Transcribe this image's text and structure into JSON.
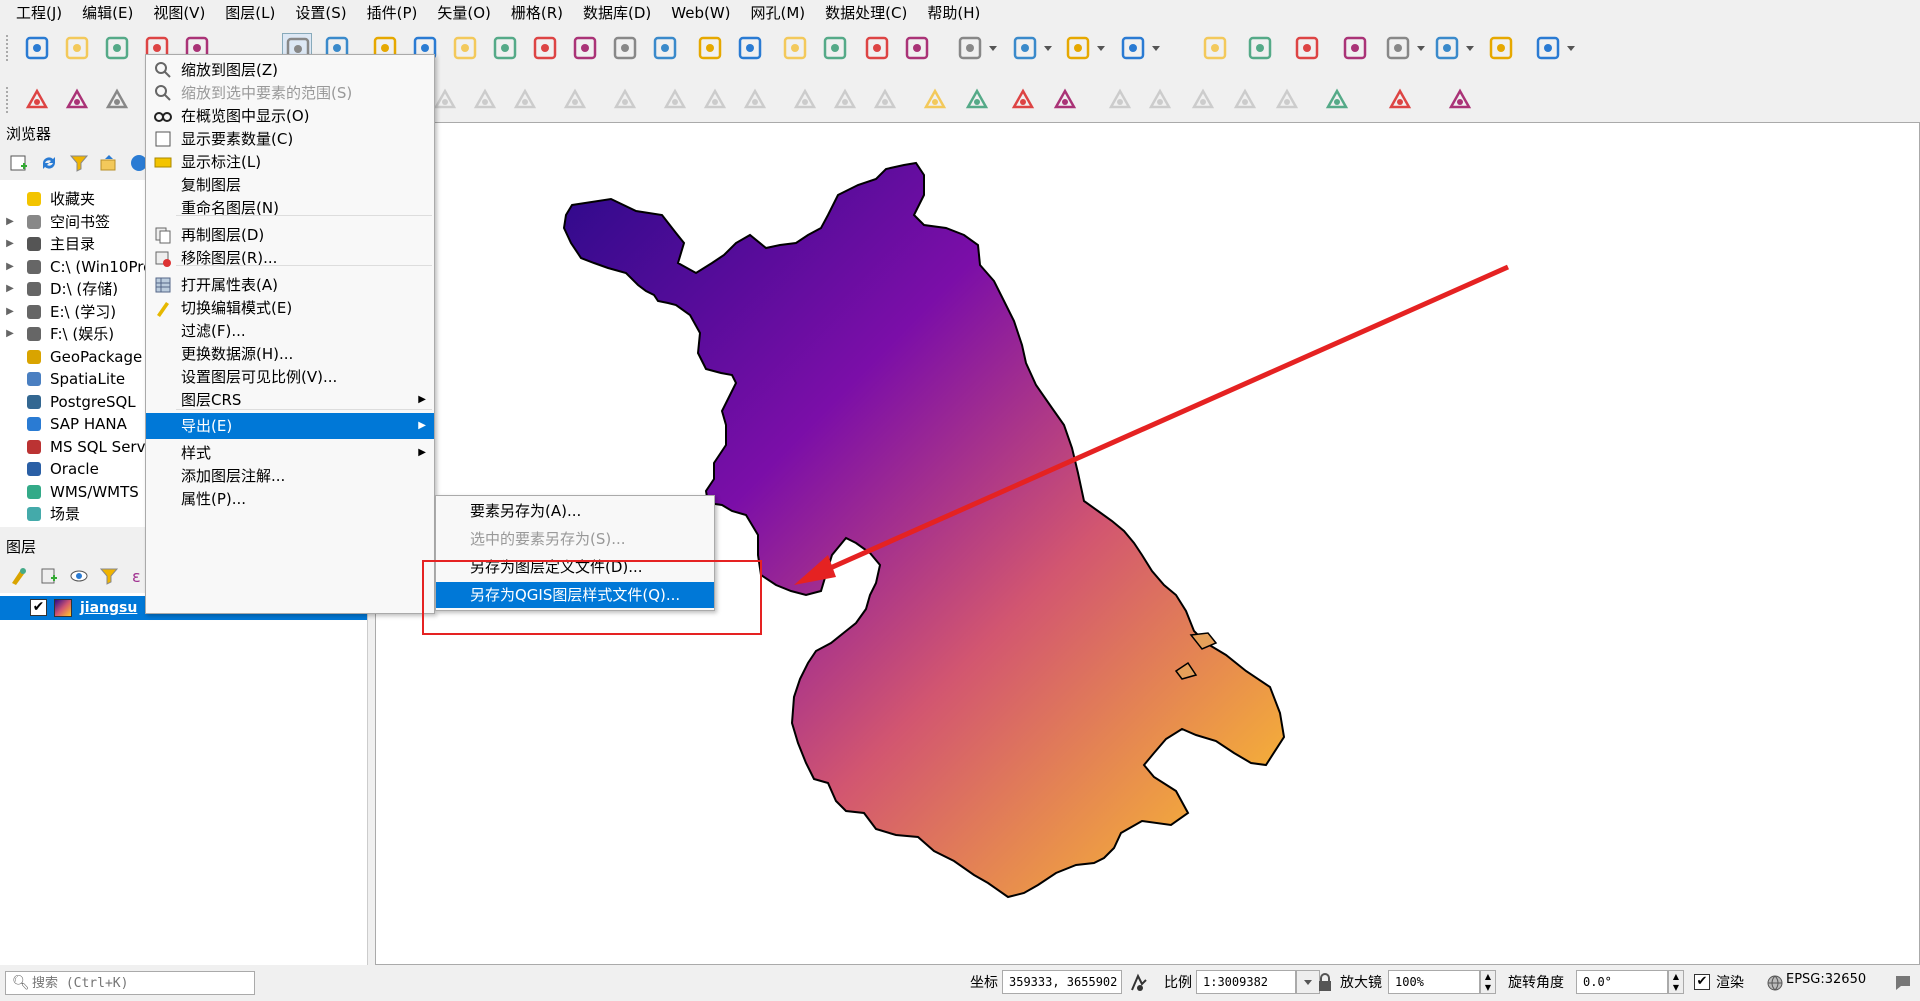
{
  "menubar": [
    "工程(J)",
    "编辑(E)",
    "视图(V)",
    "图层(L)",
    "设置(S)",
    "插件(P)",
    "矢量(O)",
    "栅格(R)",
    "数据库(D)",
    "Web(W)",
    "网孔(M)",
    "数据处理(C)",
    "帮助(H)"
  ],
  "browser": {
    "title": "浏览器",
    "items": [
      {
        "label": "收藏夹",
        "icon": "star-icon",
        "expand": false
      },
      {
        "label": "空间书签",
        "icon": "bookmark-icon",
        "expand": true
      },
      {
        "label": "主目录",
        "icon": "home-icon",
        "expand": true
      },
      {
        "label": "C:\\ (Win10Pro",
        "icon": "drive-icon",
        "expand": true
      },
      {
        "label": "D:\\ (存储)",
        "icon": "drive-icon",
        "expand": true
      },
      {
        "label": "E:\\ (学习)",
        "icon": "drive-icon",
        "expand": true
      },
      {
        "label": "F:\\ (娱乐)",
        "icon": "drive-icon",
        "expand": true
      },
      {
        "label": "GeoPackage",
        "icon": "geopackage-icon",
        "expand": false
      },
      {
        "label": "SpatiaLite",
        "icon": "spatialite-icon",
        "expand": false
      },
      {
        "label": "PostgreSQL",
        "icon": "postgresql-icon",
        "expand": false
      },
      {
        "label": "SAP HANA",
        "icon": "sap-hana-icon",
        "expand": false
      },
      {
        "label": "MS SQL Serv",
        "icon": "mssql-icon",
        "expand": false
      },
      {
        "label": "Oracle",
        "icon": "oracle-icon",
        "expand": false
      },
      {
        "label": "WMS/WMTS",
        "icon": "wms-icon",
        "expand": false
      },
      {
        "label": "场景",
        "icon": "scene-icon",
        "expand": false
      }
    ]
  },
  "layers": {
    "title": "图层",
    "layer_name": "jiangsu",
    "checked": true
  },
  "context_menu": {
    "items": [
      {
        "label": "缩放到图层(Z)",
        "icon": "zoom-layer-icon",
        "disabled": false
      },
      {
        "label": "缩放到选中要素的范围(S)",
        "icon": "zoom-selected-icon",
        "disabled": true
      },
      {
        "label": "在概览图中显示(O)",
        "icon": "overview-icon",
        "disabled": false
      },
      {
        "label": "显示要素数量(C)",
        "icon": "checkbox-icon",
        "disabled": false
      },
      {
        "label": "显示标注(L)",
        "icon": "label-icon",
        "disabled": false
      },
      {
        "label": "复制图层",
        "icon": "",
        "disabled": false
      },
      {
        "label": "重命名图层(N)",
        "icon": "",
        "disabled": false
      },
      {
        "label": "再制图层(D)",
        "icon": "duplicate-icon",
        "disabled": false
      },
      {
        "label": "移除图层(R)...",
        "icon": "remove-icon",
        "disabled": false
      },
      {
        "label": "打开属性表(A)",
        "icon": "table-icon",
        "disabled": false
      },
      {
        "label": "切换编辑模式(E)",
        "icon": "pencil-icon",
        "disabled": false
      },
      {
        "label": "过滤(F)...",
        "icon": "",
        "disabled": false
      },
      {
        "label": "更换数据源(H)...",
        "icon": "",
        "disabled": false
      },
      {
        "label": "设置图层可见比例(V)...",
        "icon": "",
        "disabled": false
      },
      {
        "label": "图层CRS",
        "icon": "",
        "disabled": false,
        "submenu": true
      },
      {
        "label": "导出(E)",
        "icon": "",
        "disabled": false,
        "submenu": true,
        "selected": true
      },
      {
        "label": "样式",
        "icon": "",
        "disabled": false,
        "submenu": true
      },
      {
        "label": "添加图层注解...",
        "icon": "",
        "disabled": false
      },
      {
        "label": "属性(P)...",
        "icon": "",
        "disabled": false
      }
    ]
  },
  "export_submenu": {
    "items": [
      {
        "label": "要素另存为(A)...",
        "disabled": false,
        "selected": false
      },
      {
        "label": "选中的要素另存为(S)...",
        "disabled": true,
        "selected": false
      },
      {
        "label": "另存为图层定义文件(D)...",
        "disabled": false,
        "selected": false
      },
      {
        "label": "另存为QGIS图层样式文件(Q)...",
        "disabled": false,
        "selected": true
      }
    ]
  },
  "status": {
    "search_placeholder": "搜索 (Ctrl+K)",
    "coord_label": "坐标",
    "coord_value": "359333, 3655902",
    "scale_label": "比例",
    "scale_value": "1:3009382",
    "magnifier_label": "放大镜",
    "magnifier_value": "100%",
    "rotation_label": "旋转角度",
    "rotation_value": "0.0°",
    "render_label": "渲染",
    "crs": "EPSG:32650"
  },
  "colors": {
    "selection": "#0078d7",
    "annotation_red": "#e52222",
    "gradient_start": "#2c0a8a",
    "gradient_mid1": "#7b0ea8",
    "gradient_mid2": "#d25670",
    "gradient_end": "#ffc928"
  }
}
